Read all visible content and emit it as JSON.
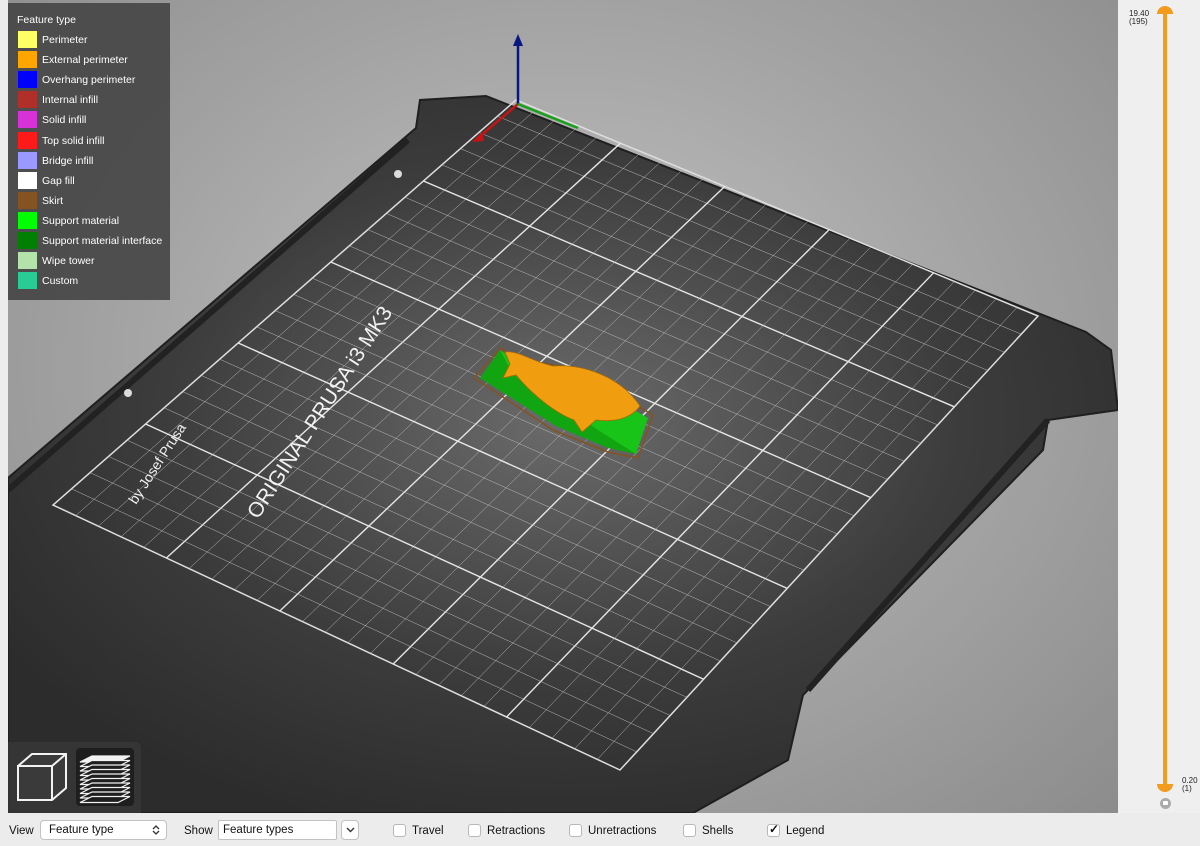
{
  "legend": {
    "title": "Feature type",
    "items": [
      {
        "label": "Perimeter",
        "color": "#FFFF66"
      },
      {
        "label": "External perimeter",
        "color": "#FFA500"
      },
      {
        "label": "Overhang perimeter",
        "color": "#0000FF"
      },
      {
        "label": "Internal infill",
        "color": "#B03029"
      },
      {
        "label": "Solid infill",
        "color": "#D732D7"
      },
      {
        "label": "Top solid infill",
        "color": "#FF1A1A"
      },
      {
        "label": "Bridge infill",
        "color": "#9999FF"
      },
      {
        "label": "Gap fill",
        "color": "#FFFFFF"
      },
      {
        "label": "Skirt",
        "color": "#845321"
      },
      {
        "label": "Support material",
        "color": "#00FF00"
      },
      {
        "label": "Support material interface",
        "color": "#008000"
      },
      {
        "label": "Wipe tower",
        "color": "#B3E3AB"
      },
      {
        "label": "Custom",
        "color": "#28CC94"
      }
    ]
  },
  "bed": {
    "brand_line1": "ORIGINAL PRUSA i3 MK3",
    "brand_line2": "by Josef Prusa"
  },
  "layer_slider": {
    "top_value": "19.40",
    "top_layer": "(195)",
    "bottom_value": "0.20",
    "bottom_layer": "(1)",
    "accent_color": "#F29B1C"
  },
  "toolbar": {
    "view_label": "View",
    "view_value": "Feature type",
    "show_label": "Show",
    "show_value": "Feature types",
    "options": [
      {
        "label": "Travel",
        "checked": false
      },
      {
        "label": "Retractions",
        "checked": false
      },
      {
        "label": "Unretractions",
        "checked": false
      },
      {
        "label": "Shells",
        "checked": false
      },
      {
        "label": "Legend",
        "checked": true
      }
    ]
  },
  "view_buttons": [
    "cube-view-icon",
    "layers-view-icon"
  ]
}
